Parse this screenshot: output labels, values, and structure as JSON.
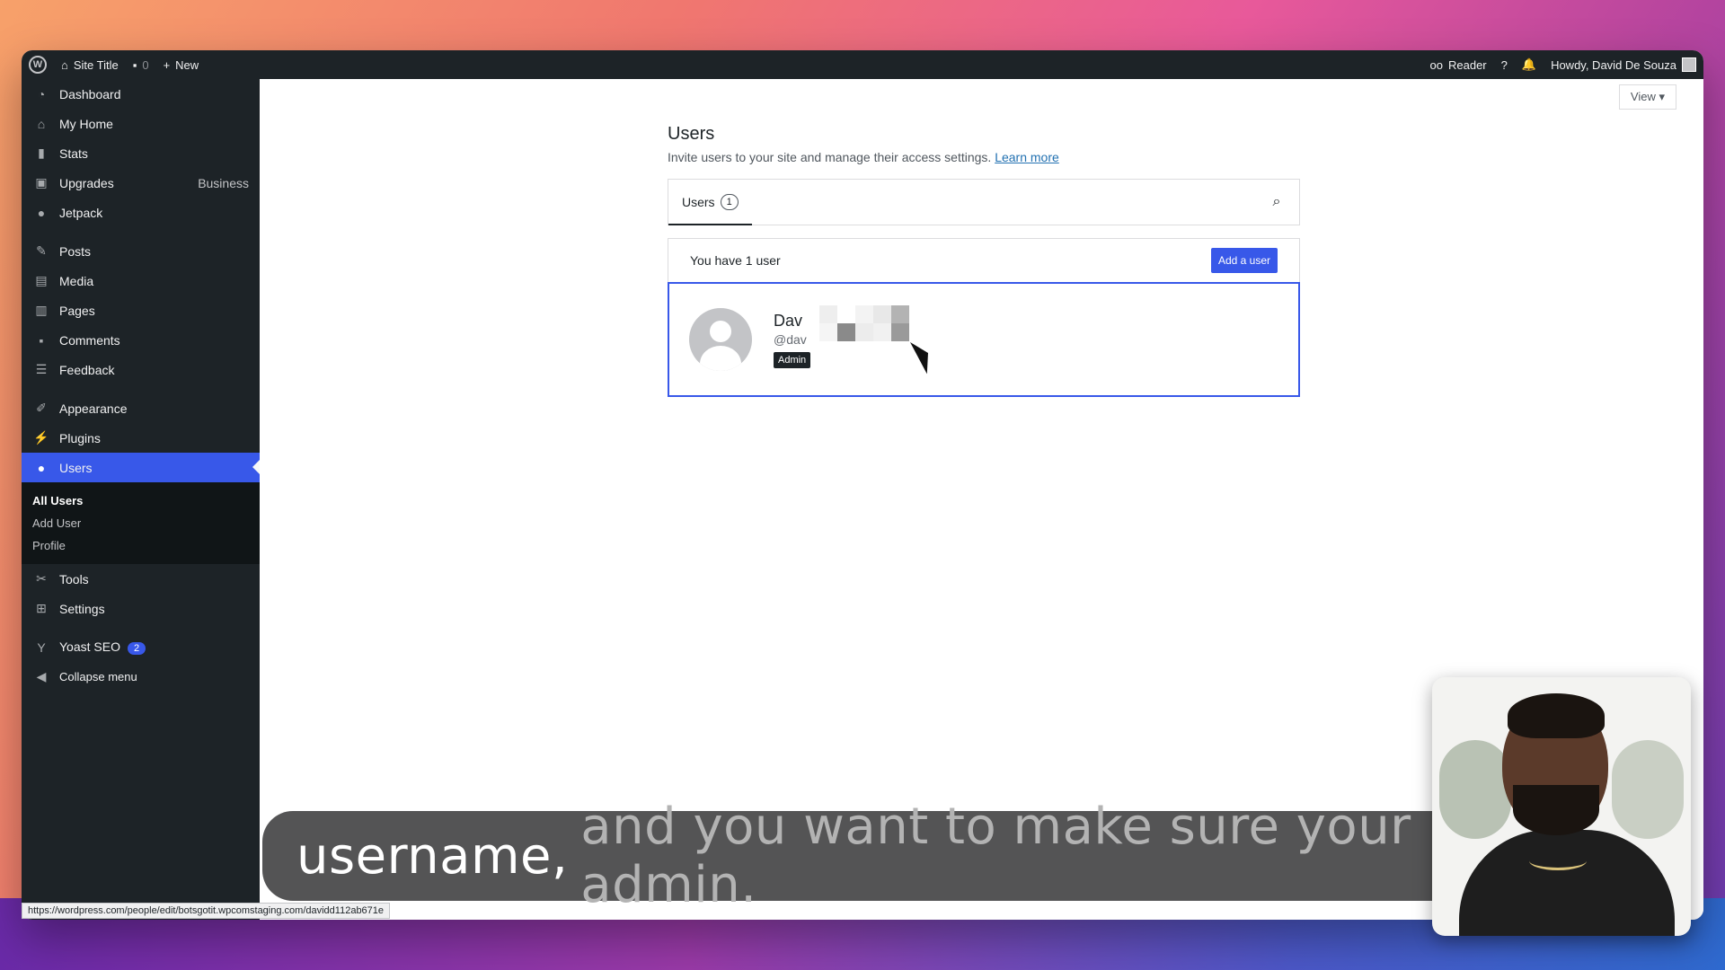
{
  "adminbar": {
    "site_title": "Site Title",
    "comments_count": "0",
    "new_label": "New",
    "reader_label": "Reader",
    "help_label": "?",
    "howdy": "Howdy, David De Souza"
  },
  "sidebar": {
    "items": [
      {
        "label": "Dashboard",
        "icon": "dashboard-icon"
      },
      {
        "label": "My Home",
        "icon": "home-icon"
      },
      {
        "label": "Stats",
        "icon": "stats-icon"
      },
      {
        "label": "Upgrades",
        "icon": "cart-icon",
        "right": "Business"
      },
      {
        "label": "Jetpack",
        "icon": "jetpack-icon"
      },
      {
        "label": "Posts",
        "icon": "pin-icon"
      },
      {
        "label": "Media",
        "icon": "media-icon"
      },
      {
        "label": "Pages",
        "icon": "pages-icon"
      },
      {
        "label": "Comments",
        "icon": "comment-icon"
      },
      {
        "label": "Feedback",
        "icon": "feedback-icon"
      },
      {
        "label": "Appearance",
        "icon": "brush-icon"
      },
      {
        "label": "Plugins",
        "icon": "plug-icon"
      },
      {
        "label": "Users",
        "icon": "user-icon"
      },
      {
        "label": "Tools",
        "icon": "wrench-icon"
      },
      {
        "label": "Settings",
        "icon": "settings-icon"
      },
      {
        "label": "Yoast SEO",
        "icon": "yoast-icon",
        "badge": "2"
      },
      {
        "label": "Collapse menu",
        "icon": "collapse-icon"
      }
    ],
    "users_submenu": [
      "All Users",
      "Add User",
      "Profile"
    ]
  },
  "main": {
    "view_label": "View",
    "title": "Users",
    "description": "Invite users to your site and manage their access settings.",
    "learn_more": "Learn more",
    "tab_label": "Users",
    "tab_count": "1",
    "summary": "You have 1 user",
    "add_user": "Add a user",
    "user": {
      "name": "Dav",
      "handle": "@dav",
      "role": "Admin"
    }
  },
  "caption": {
    "active": "username,",
    "rest": "and you want to make sure your admin."
  },
  "status_url": "https://wordpress.com/people/edit/botsgotit.wpcomstaging.com/davidd112ab671e"
}
